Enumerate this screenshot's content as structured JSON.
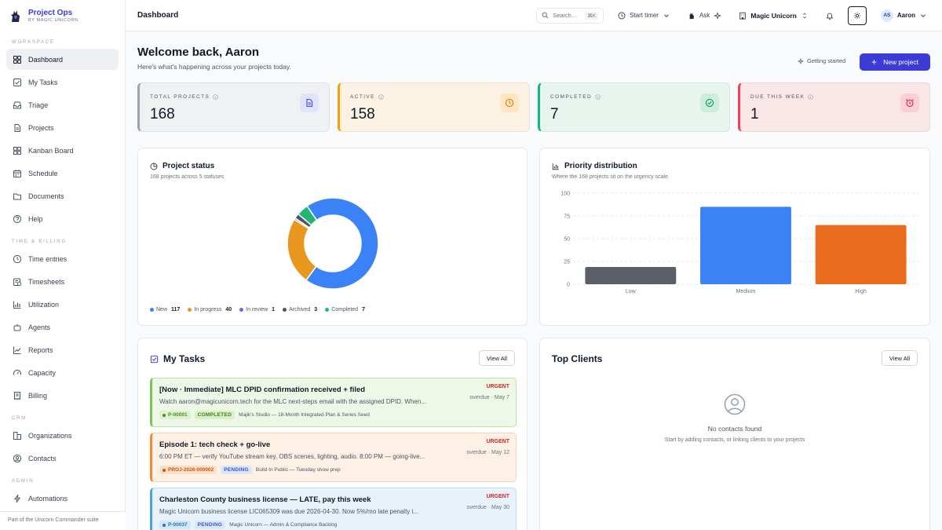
{
  "brand": {
    "name": "Project Ops",
    "subtitle": "BY MAGIC UNICORN"
  },
  "sidebar": {
    "sections": [
      {
        "title": "WORKSPACE",
        "items": [
          {
            "label": "Dashboard",
            "icon": "grid-icon",
            "active": true
          },
          {
            "label": "My Tasks",
            "icon": "checkbox-icon"
          },
          {
            "label": "Triage",
            "icon": "inbox-icon"
          },
          {
            "label": "Projects",
            "icon": "file-icon"
          },
          {
            "label": "Kanban Board",
            "icon": "kanban-icon"
          },
          {
            "label": "Schedule",
            "icon": "calendar-icon"
          },
          {
            "label": "Documents",
            "icon": "folder-icon"
          },
          {
            "label": "Help",
            "icon": "help-icon"
          }
        ]
      },
      {
        "title": "TIME & BILLING",
        "items": [
          {
            "label": "Time entries",
            "icon": "clock-icon"
          },
          {
            "label": "Timesheets",
            "icon": "timesheet-icon"
          },
          {
            "label": "Utilization",
            "icon": "bar-chart-icon"
          },
          {
            "label": "Agents",
            "icon": "bot-icon"
          },
          {
            "label": "Reports",
            "icon": "trend-icon"
          },
          {
            "label": "Capacity",
            "icon": "gauge-icon"
          },
          {
            "label": "Billing",
            "icon": "receipt-icon"
          }
        ]
      },
      {
        "title": "CRM",
        "items": [
          {
            "label": "Organizations",
            "icon": "building-icon"
          },
          {
            "label": "Contacts",
            "icon": "contact-icon"
          }
        ]
      },
      {
        "title": "ADMIN",
        "items": [
          {
            "label": "Automations",
            "icon": "bolt-icon"
          }
        ]
      }
    ],
    "footer": "Part of the Unicorn Commander suite"
  },
  "topbar": {
    "title": "Dashboard",
    "search_placeholder": "Search...",
    "search_shortcut": "⌘K",
    "start_timer": "Start timer",
    "ask": "Ask",
    "org": "Magic Unicorn",
    "user_initials": "AS",
    "user_name": "Aaron"
  },
  "welcome": {
    "title": "Welcome back, Aaron",
    "subtitle": "Here's what's happening across your projects today.",
    "getting_started": "Getting started",
    "new_project": "New project"
  },
  "stats": [
    {
      "label": "TOTAL PROJECTS",
      "value": "168",
      "icon": "document-icon",
      "accent": "#9ca3af",
      "bg": "#f0f1f3",
      "icon_bg": "#dfe3fb",
      "icon_color": "#4f46e5"
    },
    {
      "label": "ACTIVE",
      "value": "158",
      "icon": "clock-icon",
      "accent": "#f59e0b",
      "bg": "#fbf2e3",
      "icon_bg": "#fde6c0",
      "icon_color": "#d97706"
    },
    {
      "label": "COMPLETED",
      "value": "7",
      "icon": "check-circle-icon",
      "accent": "#10b981",
      "bg": "#e7f5ee",
      "icon_bg": "#ccefdc",
      "icon_color": "#059669"
    },
    {
      "label": "DUE THIS WEEK",
      "value": "1",
      "icon": "alarm-icon",
      "accent": "#f43f5e",
      "bg": "#fbe6e8",
      "icon_bg": "#f9d0d4",
      "icon_color": "#e11d48"
    }
  ],
  "project_status": {
    "title": "Project status",
    "subtitle": "168 projects across 5 statuses"
  },
  "priority": {
    "title": "Priority distribution",
    "subtitle": "Where the 168 projects sit on the urgency scale"
  },
  "chart_data": [
    {
      "type": "pie",
      "donut": true,
      "labels": [
        "New",
        "In progress",
        "In review",
        "Archived",
        "Completed"
      ],
      "values": [
        117,
        40,
        1,
        3,
        7
      ],
      "colors": [
        "#3b82f6",
        "#e8981f",
        "#6366f1",
        "#4b5563",
        "#22b573"
      ],
      "legend": "bottom"
    },
    {
      "type": "bar",
      "categories": [
        "Low",
        "Medium",
        "High"
      ],
      "values": [
        19,
        85,
        65
      ],
      "colors": [
        "#5b6068",
        "#3b82f6",
        "#ea6b1e"
      ],
      "ylim": [
        0,
        100
      ],
      "yticks": [
        100,
        75,
        50,
        25,
        0
      ],
      "grid": true
    }
  ],
  "tasks": {
    "title": "My Tasks",
    "view_all": "View All",
    "items": [
      {
        "title": "[Now · Immediate] MLC DPID confirmation received + filed",
        "desc": "Watch aaron@magicunicorn.tech for the MLC next-steps email with the assigned DPID. When...",
        "id": "P-00001",
        "status": "COMPLETED",
        "project": "Majik's Studio — 18-Month Integrated Plan & Series Seed",
        "priority": "URGENT",
        "due": "overdue · May 7",
        "bg": "#eef8e6",
        "border": "#bfe3a7",
        "accent": "#7cc555",
        "id_bg": "#dff2cf",
        "id_color": "#4d8a2a",
        "status_bg": "#d9f0c8",
        "status_color": "#3f7a1f"
      },
      {
        "title": "Episode 1: tech check + go-live",
        "desc": "6:00 PM ET — verify YouTube stream key, OBS scenes, lighting, audio. 8:00 PM — going-live...",
        "id": "PROJ-2026-000002",
        "status": "PENDING",
        "project": "Build In Public — Tuesday show prep",
        "priority": "URGENT",
        "due": "overdue · May 12",
        "bg": "#fdf0e4",
        "border": "#f5d2b1",
        "accent": "#f08a35",
        "id_bg": "#fbe0c8",
        "id_color": "#c2571b",
        "status_bg": "#dbe5fb",
        "status_color": "#3056c5"
      },
      {
        "title": "Charleston County business license — LATE, pay this week",
        "desc": "Magic Unicorn business license LIC065309 was due 2026-04-30. Now 5%/mo late penalty i...",
        "id": "P-00037",
        "status": "PENDING",
        "project": "Magic Unicorn — Admin & Compliance Backlog",
        "priority": "URGENT",
        "due": "overdue · May 30",
        "bg": "#e7f2fb",
        "border": "#bfdcf2",
        "accent": "#4aa3e0",
        "id_bg": "#d3e7f8",
        "id_color": "#2573b1",
        "status_bg": "#dbe5fb",
        "status_color": "#3056c5"
      }
    ]
  },
  "clients": {
    "title": "Top Clients",
    "view_all": "View All",
    "empty_title": "No contacts found",
    "empty_sub": "Start by adding contacts, or linking clients to your projects"
  }
}
